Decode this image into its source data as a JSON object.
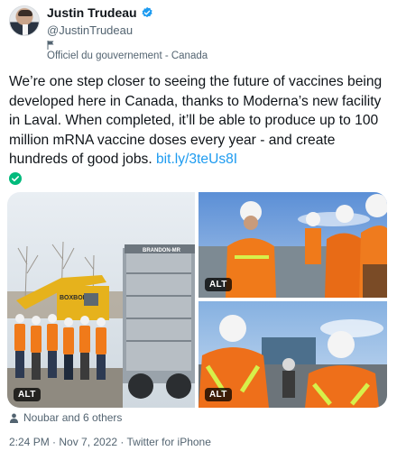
{
  "author": {
    "display_name": "Justin Trudeau",
    "handle": "@JustinTrudeau",
    "label": "Officiel du gouvernement - Canada",
    "verified_color": "#1d9bf0"
  },
  "tweet": {
    "text": "We’re one step closer to seeing the future of vaccines being developed here in Canada, thanks to Moderna’s new facility in Laval. When completed, it’ll be able to produce up to 100 million mRNA vaccine doses every year - and create hundreds of good jobs. ",
    "link": "bit.ly/3teUs8I",
    "link_color": "#1d9bf0"
  },
  "photos": [
    {
      "alt_badge": "ALT",
      "signs": {
        "truck": "BRANDON-MR",
        "excavator": "BOXBORO"
      }
    },
    {
      "alt_badge": "ALT"
    },
    {
      "alt_badge": "ALT"
    }
  ],
  "likes": {
    "text": "Noubar and 6 others"
  },
  "meta": {
    "timestamp": "2:24 PM · Nov 7, 2022 · Twitter for iPhone"
  }
}
